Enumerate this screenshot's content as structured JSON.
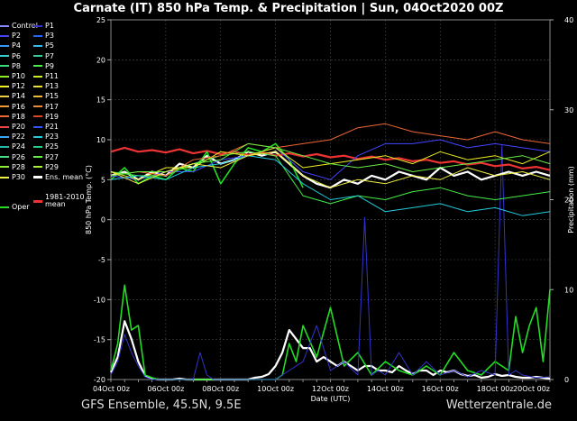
{
  "header": {
    "title": "Carnate  (IT)  850 hPa Temp. & Precipitation | Sun, 04Oct2020 00Z"
  },
  "footer": {
    "left": "GFS Ensemble, 45.5N, 9.5E",
    "right": "Wetterzentrale.de"
  },
  "chart_data": {
    "type": "line",
    "title": "Carnate  (IT)  850 hPa Temp. & Precipitation | Sun, 04Oct2020 00Z",
    "xlabel": "Date (UTC)",
    "ylabel": "850 hPa Temp. (°C)",
    "y2label": "Precipitation (mm)",
    "x_ticks": [
      "04Oct 00z",
      "06Oct 00z",
      "08Oct 00z",
      "10Oct 00z",
      "12Oct 00z",
      "14Oct 00z",
      "16Oct 00z",
      "18Oct 00z",
      "20Oct 00z"
    ],
    "x_range_hours": [
      0,
      384
    ],
    "ylim": [
      -20,
      25
    ],
    "y_ticks": [
      -20,
      -15,
      -10,
      -5,
      0,
      5,
      10,
      15,
      20,
      25
    ],
    "y2lim": [
      0,
      40
    ],
    "y2_ticks": [
      0,
      10,
      20,
      30,
      40
    ],
    "grid": true,
    "legend_position": "left",
    "legend": [
      {
        "name": "Control",
        "color": "#8888ff"
      },
      {
        "name": "P1",
        "color": "#3333cc"
      },
      {
        "name": "P2",
        "color": "#4444ff"
      },
      {
        "name": "P3",
        "color": "#2266ff"
      },
      {
        "name": "P4",
        "color": "#3399ff"
      },
      {
        "name": "P5",
        "color": "#33bbee"
      },
      {
        "name": "P6",
        "color": "#33cccc"
      },
      {
        "name": "P7",
        "color": "#33cc99"
      },
      {
        "name": "P8",
        "color": "#33dd77"
      },
      {
        "name": "P9",
        "color": "#44ee44"
      },
      {
        "name": "P10",
        "color": "#88ee22"
      },
      {
        "name": "P11",
        "color": "#ccee22"
      },
      {
        "name": "P12",
        "color": "#eeee22"
      },
      {
        "name": "P13",
        "color": "#eedd33"
      },
      {
        "name": "P14",
        "color": "#eecc44"
      },
      {
        "name": "P15",
        "color": "#eebb33"
      },
      {
        "name": "P16",
        "color": "#ee9933"
      },
      {
        "name": "P17",
        "color": "#ee8833"
      },
      {
        "name": "P18",
        "color": "#ee6633"
      },
      {
        "name": "P19",
        "color": "#dd4422"
      },
      {
        "name": "P20",
        "color": "#ee4444"
      },
      {
        "name": "P21",
        "color": "#3355ff"
      },
      {
        "name": "P22",
        "color": "#33aaff"
      },
      {
        "name": "P23",
        "color": "#22ccdd"
      },
      {
        "name": "P24",
        "color": "#22bbaa"
      },
      {
        "name": "P25",
        "color": "#22cc88"
      },
      {
        "name": "P26",
        "color": "#44dd88"
      },
      {
        "name": "P27",
        "color": "#66ee44"
      },
      {
        "name": "P28",
        "color": "#88ee33"
      },
      {
        "name": "P29",
        "color": "#aaee33"
      },
      {
        "name": "P30",
        "color": "#eeee44"
      },
      {
        "name": "Ens. mean",
        "color": "#ffffff"
      },
      {
        "name": "1981-2010 mean",
        "color": "#ee3333"
      },
      {
        "name": "Oper",
        "color": "#22dd22"
      }
    ],
    "series": [
      {
        "name": "Ens. mean",
        "axis": "temp",
        "color": "#ffffff",
        "x": [
          0,
          12,
          24,
          36,
          48,
          60,
          72,
          84,
          96,
          108,
          120,
          132,
          144,
          156,
          168,
          180,
          192,
          204,
          216,
          228,
          240,
          252,
          264,
          276,
          288,
          300,
          312,
          324,
          336,
          348,
          360,
          372,
          384
        ],
        "y": [
          5.5,
          6.0,
          5.0,
          6.0,
          5.5,
          7.0,
          6.5,
          8.0,
          7.0,
          7.5,
          8.5,
          8.0,
          8.5,
          7.0,
          5.5,
          4.5,
          4.0,
          5.0,
          4.5,
          5.5,
          5.0,
          6.0,
          5.5,
          5.0,
          6.5,
          5.5,
          6.0,
          5.0,
          5.5,
          6.0,
          5.5,
          6.0,
          5.5
        ]
      },
      {
        "name": "1981-2010 mean",
        "axis": "temp",
        "color": "#ee3333",
        "x": [
          0,
          12,
          24,
          36,
          48,
          60,
          72,
          84,
          96,
          108,
          120,
          132,
          144,
          156,
          168,
          180,
          192,
          204,
          216,
          228,
          240,
          252,
          264,
          276,
          288,
          300,
          312,
          324,
          336,
          348,
          360,
          372,
          384
        ],
        "y": [
          8.5,
          9.0,
          8.5,
          8.7,
          8.4,
          8.8,
          8.3,
          8.6,
          8.2,
          8.5,
          8.1,
          8.4,
          8.0,
          8.3,
          7.9,
          8.2,
          7.8,
          8.0,
          7.6,
          7.9,
          7.5,
          7.7,
          7.3,
          7.5,
          7.1,
          7.3,
          6.9,
          7.1,
          6.7,
          6.9,
          6.4,
          6.6,
          6.2
        ]
      },
      {
        "name": "Oper",
        "axis": "temp",
        "color": "#22dd22",
        "x": [
          0,
          12,
          24,
          36,
          48,
          60,
          72,
          84,
          96,
          108,
          120,
          132,
          144,
          156,
          168
        ],
        "y": [
          5.0,
          6.5,
          4.5,
          5.5,
          5.0,
          6.5,
          6.0,
          8.5,
          4.5,
          7.0,
          9.0,
          8.5,
          9.5,
          7.5,
          4.0
        ]
      },
      {
        "name": "P2",
        "axis": "temp",
        "color": "#4444ff",
        "x": [
          0,
          24,
          48,
          72,
          96,
          120,
          144,
          168,
          192,
          216,
          240,
          264,
          288,
          312,
          336,
          360,
          384
        ],
        "y": [
          5.5,
          5.0,
          6.0,
          6.0,
          7.5,
          8.0,
          9.0,
          6.0,
          5.0,
          8.0,
          9.5,
          9.5,
          10.0,
          9.0,
          9.5,
          9.0,
          8.5
        ]
      },
      {
        "name": "P9",
        "axis": "temp",
        "color": "#44ee44",
        "x": [
          0,
          24,
          48,
          72,
          96,
          120,
          144,
          168,
          192,
          216,
          240,
          264,
          288,
          312,
          336,
          360,
          384
        ],
        "y": [
          6.0,
          5.5,
          5.5,
          7.0,
          8.0,
          8.5,
          8.0,
          3.0,
          2.0,
          3.0,
          2.5,
          3.5,
          4.0,
          3.0,
          2.5,
          3.0,
          3.5
        ]
      },
      {
        "name": "P12",
        "axis": "temp",
        "color": "#eeee22",
        "x": [
          0,
          24,
          48,
          72,
          96,
          120,
          144,
          168,
          192,
          216,
          240,
          264,
          288,
          312,
          336,
          360,
          384
        ],
        "y": [
          6.0,
          5.0,
          6.5,
          6.5,
          8.5,
          8.0,
          9.0,
          6.5,
          7.0,
          7.5,
          8.0,
          7.0,
          8.5,
          7.5,
          8.0,
          7.0,
          8.5
        ]
      },
      {
        "name": "P18",
        "axis": "temp",
        "color": "#ee6633",
        "x": [
          0,
          24,
          48,
          72,
          96,
          120,
          144,
          168,
          192,
          216,
          240,
          264,
          288,
          312,
          336,
          360,
          384
        ],
        "y": [
          5.5,
          6.0,
          5.5,
          7.5,
          8.0,
          9.5,
          9.0,
          9.5,
          10.0,
          11.5,
          12.0,
          11.0,
          10.5,
          10.0,
          11.0,
          10.0,
          9.5
        ]
      },
      {
        "name": "P23",
        "axis": "temp",
        "color": "#22ccdd",
        "x": [
          0,
          24,
          48,
          72,
          96,
          120,
          144,
          168,
          192,
          216,
          240,
          264,
          288,
          312,
          336,
          360,
          384
        ],
        "y": [
          5.0,
          5.5,
          5.0,
          6.5,
          7.0,
          8.0,
          7.5,
          4.5,
          2.5,
          3.0,
          1.0,
          1.5,
          2.0,
          1.0,
          1.5,
          0.5,
          1.0
        ]
      },
      {
        "name": "P27",
        "axis": "temp",
        "color": "#66ee44",
        "x": [
          0,
          24,
          48,
          72,
          96,
          120,
          144,
          168,
          192,
          216,
          240,
          264,
          288,
          312,
          336,
          360,
          384
        ],
        "y": [
          5.5,
          6.0,
          6.0,
          7.0,
          7.5,
          9.5,
          9.0,
          8.0,
          7.0,
          6.5,
          7.0,
          6.0,
          6.5,
          7.0,
          7.5,
          8.0,
          7.0
        ]
      },
      {
        "name": "P30",
        "axis": "temp",
        "color": "#eeee44",
        "x": [
          0,
          24,
          48,
          72,
          96,
          120,
          144,
          168,
          192,
          216,
          240,
          264,
          288,
          312,
          336,
          360,
          384
        ],
        "y": [
          6.0,
          4.5,
          6.0,
          7.0,
          6.5,
          8.0,
          8.5,
          5.5,
          4.0,
          5.0,
          4.5,
          5.5,
          5.0,
          6.5,
          5.5,
          6.0,
          5.0
        ]
      },
      {
        "name": "Ens. mean",
        "axis": "precip",
        "color": "#ffffff",
        "x": [
          0,
          6,
          12,
          18,
          24,
          30,
          36,
          42,
          48,
          54,
          60,
          66,
          72,
          78,
          84,
          90,
          96,
          102,
          108,
          114,
          120,
          126,
          132,
          138,
          144,
          150,
          156,
          162,
          168,
          174,
          180,
          186,
          192,
          198,
          204,
          210,
          216,
          222,
          228,
          234,
          240,
          246,
          252,
          258,
          264,
          270,
          276,
          282,
          288,
          294,
          300,
          306,
          312,
          318,
          324,
          330,
          336,
          342,
          348,
          354,
          360,
          366,
          372,
          378,
          384
        ],
        "y": [
          0.8,
          2.5,
          6.5,
          4.5,
          2.0,
          0.4,
          0.1,
          0.0,
          0.0,
          0.0,
          0.1,
          0.0,
          0.0,
          0.0,
          0.0,
          0.0,
          0.0,
          0.0,
          0.0,
          0.0,
          0.0,
          0.2,
          0.3,
          0.6,
          1.5,
          3.0,
          5.5,
          4.5,
          3.5,
          3.5,
          2.0,
          2.5,
          2.0,
          1.5,
          2.0,
          1.5,
          1.0,
          1.5,
          1.5,
          1.0,
          1.0,
          0.8,
          1.5,
          1.0,
          0.6,
          1.0,
          1.0,
          0.5,
          1.0,
          0.8,
          1.0,
          0.6,
          0.4,
          0.5,
          0.2,
          0.3,
          0.6,
          0.4,
          0.5,
          0.3,
          0.2,
          0.2,
          0.3,
          0.2,
          0.1
        ]
      },
      {
        "name": "Oper",
        "axis": "precip",
        "color": "#22dd22",
        "x": [
          0,
          6,
          12,
          18,
          24,
          30,
          36,
          42,
          48,
          60,
          72,
          96,
          120,
          144,
          150,
          156,
          162,
          168,
          180,
          192,
          204,
          216,
          228,
          240,
          252,
          264,
          276,
          288,
          300,
          312,
          324,
          336,
          348,
          354,
          360,
          366,
          372,
          378,
          384
        ],
        "y": [
          1.0,
          4.0,
          10.5,
          5.5,
          6.0,
          0.5,
          0.2,
          0.0,
          0.0,
          0.0,
          0.0,
          0.0,
          0.0,
          0.0,
          0.5,
          4.0,
          2.0,
          6.0,
          2.5,
          8.0,
          1.5,
          3.0,
          0.5,
          2.0,
          1.0,
          0.5,
          1.5,
          0.5,
          3.0,
          1.0,
          0.5,
          2.0,
          1.0,
          7.0,
          3.0,
          6.0,
          8.0,
          2.0,
          10.0
        ]
      },
      {
        "name": "P1",
        "axis": "precip",
        "color": "#3333cc",
        "x": [
          0,
          6,
          12,
          18,
          24,
          30,
          36,
          42,
          48,
          60,
          72,
          78,
          84,
          90,
          96,
          120,
          144,
          156,
          168,
          180,
          192,
          204,
          216,
          222,
          228,
          234,
          240,
          252,
          264,
          276,
          288,
          300,
          312,
          324,
          336,
          342,
          348,
          354,
          360,
          372,
          384
        ],
        "y": [
          0.5,
          2.0,
          5.0,
          3.0,
          1.5,
          0.3,
          0.0,
          0.0,
          0.0,
          0.0,
          0.0,
          3.0,
          0.5,
          0.0,
          0.0,
          0.0,
          0.0,
          1.0,
          2.0,
          6.0,
          1.0,
          2.0,
          0.5,
          18.0,
          0.5,
          1.0,
          0.5,
          3.0,
          0.5,
          2.0,
          0.5,
          1.0,
          0.3,
          1.0,
          0.5,
          26.0,
          0.5,
          1.0,
          0.5,
          0.2,
          0.3
        ]
      }
    ]
  }
}
